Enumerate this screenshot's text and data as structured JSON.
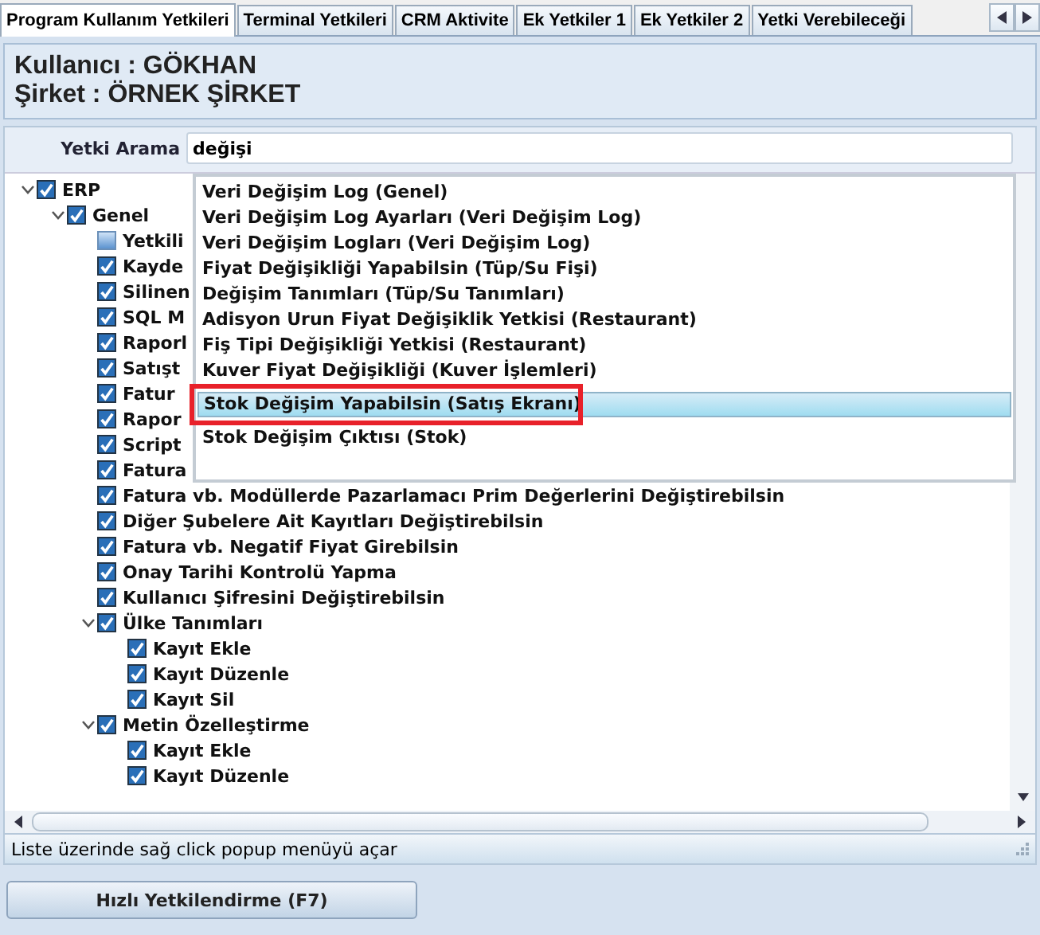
{
  "tabs": [
    {
      "label": "Program Kullanım Yetkileri",
      "selected": true
    },
    {
      "label": "Terminal Yetkileri",
      "selected": false
    },
    {
      "label": "CRM Aktivite",
      "selected": false
    },
    {
      "label": "Ek Yetkiler 1",
      "selected": false
    },
    {
      "label": "Ek Yetkiler 2",
      "selected": false
    },
    {
      "label": "Yetki Verebileceği",
      "selected": false
    }
  ],
  "header": {
    "user": "Kullanıcı : GÖKHAN",
    "company": "Şirket : ÖRNEK ŞİRKET"
  },
  "search": {
    "label": "Yetki Arama",
    "value": "değişi"
  },
  "tree": [
    {
      "label": "ERP",
      "checked": true,
      "expanded": true,
      "children": [
        {
          "label": "Genel",
          "checked": true,
          "expanded": true,
          "children": [
            {
              "label": "Yetkili",
              "partial": true
            },
            {
              "label": "Kayde",
              "checked": true
            },
            {
              "label": "Silinen",
              "checked": true
            },
            {
              "label": "SQL M",
              "checked": true
            },
            {
              "label": "Raporl",
              "checked": true
            },
            {
              "label": "Satışt",
              "checked": true
            },
            {
              "label": "Fatur",
              "checked": true
            },
            {
              "label": "Rapor",
              "checked": true
            },
            {
              "label": "Script",
              "checked": true
            },
            {
              "label": "Fatura",
              "checked": true
            },
            {
              "label": "Fatura vb. Modüllerde Pazarlamacı Prim Değerlerini Değiştirebilsin",
              "checked": true
            },
            {
              "label": "Diğer Şubelere Ait Kayıtları Değiştirebilsin",
              "checked": true
            },
            {
              "label": "Fatura vb. Negatif Fiyat Girebilsin",
              "checked": true
            },
            {
              "label": "Onay Tarihi Kontrolü Yapma",
              "checked": true
            },
            {
              "label": "Kullanıcı Şifresini Değiştirebilsin",
              "checked": true
            },
            {
              "label": "Ülke Tanımları",
              "checked": true,
              "expanded": true,
              "children": [
                {
                  "label": "Kayıt Ekle",
                  "checked": true
                },
                {
                  "label": "Kayıt Düzenle",
                  "checked": true
                },
                {
                  "label": "Kayıt Sil",
                  "checked": true
                }
              ]
            },
            {
              "label": "Metin Özelleştirme",
              "checked": true,
              "expanded": true,
              "children": [
                {
                  "label": "Kayıt Ekle",
                  "checked": true
                },
                {
                  "label": "Kayıt Düzenle",
                  "checked": true
                }
              ]
            }
          ]
        }
      ]
    }
  ],
  "suggestions": [
    {
      "label": "Veri Değişim Log (Genel)",
      "selected": false
    },
    {
      "label": "Veri Değişim Log Ayarları (Veri Değişim Log)",
      "selected": false
    },
    {
      "label": "Veri Değişim Logları (Veri Değişim Log)",
      "selected": false
    },
    {
      "label": "Fiyat Değişikliği Yapabilsin (Tüp/Su Fişi)",
      "selected": false
    },
    {
      "label": "Değişim Tanımları (Tüp/Su Tanımları)",
      "selected": false
    },
    {
      "label": "Adisyon Urun Fiyat Değişiklik Yetkisi (Restaurant)",
      "selected": false
    },
    {
      "label": "Fiş Tipi Değişikliği Yetkisi (Restaurant)",
      "selected": false
    },
    {
      "label": "Kuver Fiyat Değişikliği (Kuver İşlemleri)",
      "selected": false
    },
    {
      "label": "Stok Değişim Yapabilsin (Satış Ekranı)",
      "selected": true
    },
    {
      "label": "Stok Değişim Çıktısı (Stok)",
      "selected": false
    }
  ],
  "status_bar": "Liste üzerinde sağ click popup menüyü açar",
  "button": "Hızlı Yetkilendirme (F7)"
}
